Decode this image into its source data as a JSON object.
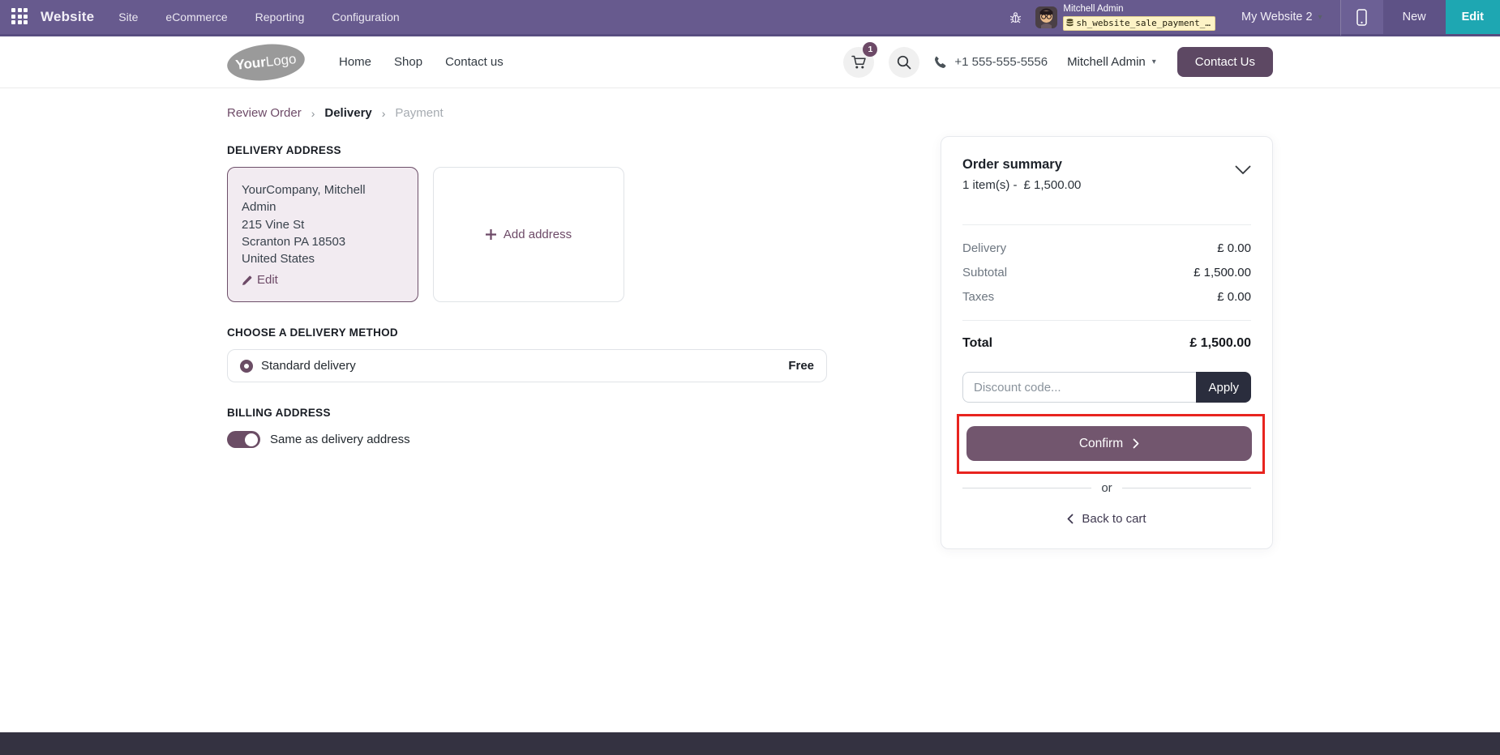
{
  "systray": {
    "app_name": "Website",
    "menus": [
      "Site",
      "eCommerce",
      "Reporting",
      "Configuration"
    ],
    "user_name": "Mitchell Admin",
    "db_name": "sh_website_sale_payment_…",
    "website_switcher": "My Website 2",
    "new_label": "New",
    "edit_label": "Edit"
  },
  "header": {
    "logo_your": "Your",
    "logo_logo": "Logo",
    "nav": [
      "Home",
      "Shop",
      "Contact us"
    ],
    "cart_count": "1",
    "phone": "+1 555-555-5556",
    "account_name": "Mitchell Admin",
    "contact_us_label": "Contact Us"
  },
  "breadcrumb": {
    "step1": "Review Order",
    "step2": "Delivery",
    "step3": "Payment"
  },
  "delivery_address": {
    "title": "DELIVERY ADDRESS",
    "selected_card": {
      "name": "YourCompany, Mitchell Admin",
      "street": "215 Vine St",
      "city": "Scranton PA 18503",
      "country": "United States",
      "edit_label": "Edit"
    },
    "add_address_label": "Add address"
  },
  "delivery_method": {
    "title": "CHOOSE A DELIVERY METHOD",
    "option_name": "Standard delivery",
    "option_price": "Free"
  },
  "billing": {
    "title": "BILLING ADDRESS",
    "toggle_label": "Same as delivery address"
  },
  "order_summary": {
    "title": "Order summary",
    "items_line": "1 item(s)  -",
    "items_amount": "£ 1,500.00",
    "rows": [
      {
        "label": "Delivery",
        "value": "£ 0.00"
      },
      {
        "label": "Subtotal",
        "value": "£ 1,500.00"
      },
      {
        "label": "Taxes",
        "value": "£ 0.00"
      }
    ],
    "total_label": "Total",
    "total_value": "£ 1,500.00",
    "discount_placeholder": "Discount code...",
    "apply_label": "Apply",
    "confirm_label": "Confirm",
    "or_label": "or",
    "back_label": "Back to cart"
  },
  "colors": {
    "topbar": "#675a8e",
    "brand_plum": "#714B67",
    "edit_teal": "#1ea7b2",
    "annotation_red": "#e8241f"
  }
}
